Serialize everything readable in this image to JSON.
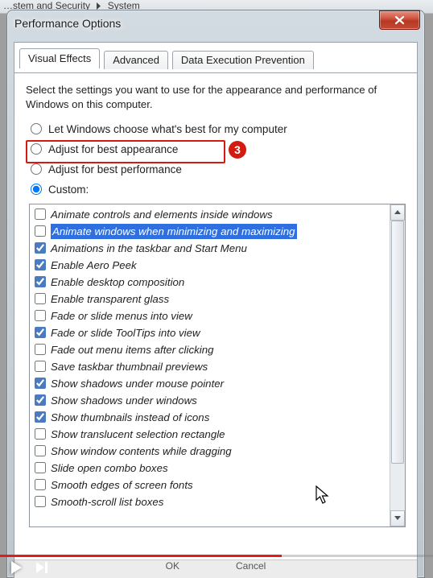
{
  "breadcrumb": {
    "seg1": "…stem and Security",
    "seg2": "System"
  },
  "window": {
    "title": "Performance Options",
    "close_symbol": "×"
  },
  "tabs": {
    "visual_effects": "Visual Effects",
    "advanced": "Advanced",
    "dep": "Data Execution Prevention"
  },
  "instruction": "Select the settings you want to use for the appearance and performance of Windows on this computer.",
  "radios": {
    "let_windows": "Let Windows choose what's best for my computer",
    "best_appearance": "Adjust for best appearance",
    "best_performance": "Adjust for best performance",
    "custom": "Custom:"
  },
  "callout": {
    "number": "3"
  },
  "options": [
    {
      "label": "Animate controls and elements inside windows",
      "checked": false,
      "selected": false
    },
    {
      "label": "Animate windows when minimizing and maximizing",
      "checked": false,
      "selected": true
    },
    {
      "label": "Animations in the taskbar and Start Menu",
      "checked": true,
      "selected": false
    },
    {
      "label": "Enable Aero Peek",
      "checked": true,
      "selected": false
    },
    {
      "label": "Enable desktop composition",
      "checked": true,
      "selected": false
    },
    {
      "label": "Enable transparent glass",
      "checked": false,
      "selected": false
    },
    {
      "label": "Fade or slide menus into view",
      "checked": false,
      "selected": false
    },
    {
      "label": "Fade or slide ToolTips into view",
      "checked": true,
      "selected": false
    },
    {
      "label": "Fade out menu items after clicking",
      "checked": false,
      "selected": false
    },
    {
      "label": "Save taskbar thumbnail previews",
      "checked": false,
      "selected": false
    },
    {
      "label": "Show shadows under mouse pointer",
      "checked": true,
      "selected": false
    },
    {
      "label": "Show shadows under windows",
      "checked": true,
      "selected": false
    },
    {
      "label": "Show thumbnails instead of icons",
      "checked": true,
      "selected": false
    },
    {
      "label": "Show translucent selection rectangle",
      "checked": false,
      "selected": false
    },
    {
      "label": "Show window contents while dragging",
      "checked": false,
      "selected": false
    },
    {
      "label": "Slide open combo boxes",
      "checked": false,
      "selected": false
    },
    {
      "label": "Smooth edges of screen fonts",
      "checked": false,
      "selected": false
    },
    {
      "label": "Smooth-scroll list boxes",
      "checked": false,
      "selected": false
    }
  ],
  "buttons": {
    "ok": "OK",
    "cancel": "Cancel"
  }
}
